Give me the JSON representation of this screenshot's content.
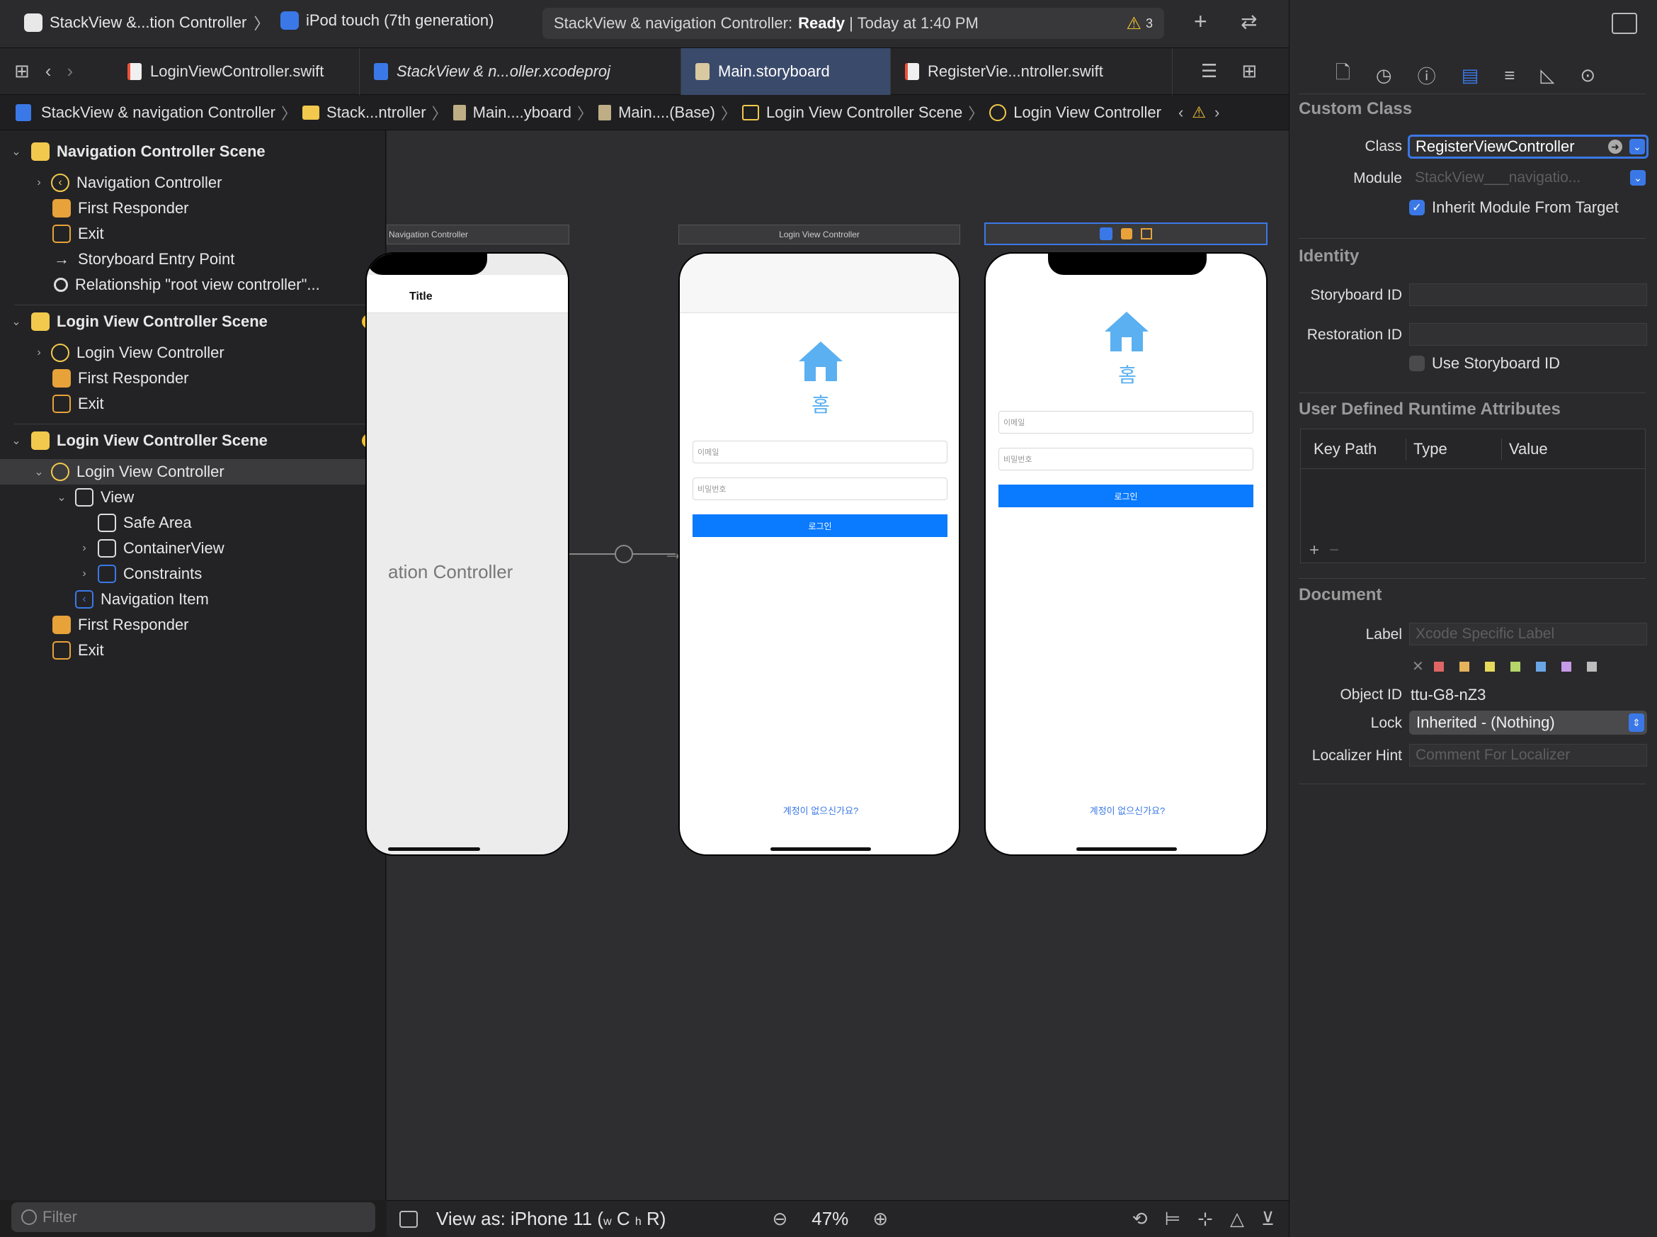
{
  "toolbar": {
    "scheme": "StackView &...tion Controller",
    "device": "iPod touch (7th generation)",
    "status_prefix": "StackView & navigation Controller:",
    "status_state": "Ready",
    "status_time": "| Today at 1:40 PM",
    "warning_count": "3"
  },
  "tabs": [
    {
      "label": "LoginViewController.swift"
    },
    {
      "label": "StackView & n...oller.xcodeproj"
    },
    {
      "label": "Main.storyboard"
    },
    {
      "label": "RegisterVie...ntroller.swift"
    }
  ],
  "jumpbar": [
    "StackView & navigation Controller",
    "Stack...ntroller",
    "Main....yboard",
    "Main....(Base)",
    "Login View Controller Scene",
    "Login View Controller"
  ],
  "outline": {
    "scene1": {
      "title": "Navigation Controller Scene",
      "items": [
        "Navigation Controller",
        "First Responder",
        "Exit",
        "Storyboard Entry Point",
        "Relationship \"root view controller\"..."
      ]
    },
    "scene2": {
      "title": "Login View Controller Scene",
      "items": [
        "Login View Controller",
        "First Responder",
        "Exit"
      ]
    },
    "scene3": {
      "title": "Login View Controller Scene",
      "items": [
        "Login View Controller",
        "View",
        "Safe Area",
        "ContainerView",
        "Constraints",
        "Navigation Item",
        "First Responder",
        "Exit"
      ]
    },
    "filter_placeholder": "Filter"
  },
  "canvas": {
    "nav_scene_label": "Navigation Controller",
    "nav_title": "Title",
    "nav_big_label": "ation Controller",
    "login_scene_label": "Login View Controller",
    "home_label": "홈",
    "email_placeholder": "이메일",
    "password_placeholder": "비밀번호",
    "login_button": "로그인",
    "no_account_link": "계정이 없으신가요?"
  },
  "bottombar": {
    "view_as": "View as: iPhone 11 (",
    "size_w": "w",
    "size_c": "C",
    "size_h": "h",
    "size_r": "R)",
    "zoom": "47%"
  },
  "inspector": {
    "custom_class": {
      "header": "Custom Class",
      "class_label": "Class",
      "class_value": "RegisterViewController",
      "module_label": "Module",
      "module_placeholder": "StackView___navigatio...",
      "inherit_label": "Inherit Module From Target"
    },
    "identity": {
      "header": "Identity",
      "storyboard_id_label": "Storyboard ID",
      "restoration_id_label": "Restoration ID",
      "use_storyboard_id_label": "Use Storyboard ID"
    },
    "runtime": {
      "header": "User Defined Runtime Attributes",
      "col_key": "Key Path",
      "col_type": "Type",
      "col_value": "Value"
    },
    "document": {
      "header": "Document",
      "label_label": "Label",
      "label_placeholder": "Xcode Specific Label",
      "object_id_label": "Object ID",
      "object_id_value": "ttu-G8-nZ3",
      "lock_label": "Lock",
      "lock_value": "Inherited - (Nothing)",
      "localizer_label": "Localizer Hint",
      "localizer_placeholder": "Comment For Localizer"
    },
    "swatches": [
      "#e06666",
      "#e6b35c",
      "#e6d95c",
      "#b5d66a",
      "#6aa6e6",
      "#c59ae6",
      "#bdbdbd"
    ]
  }
}
